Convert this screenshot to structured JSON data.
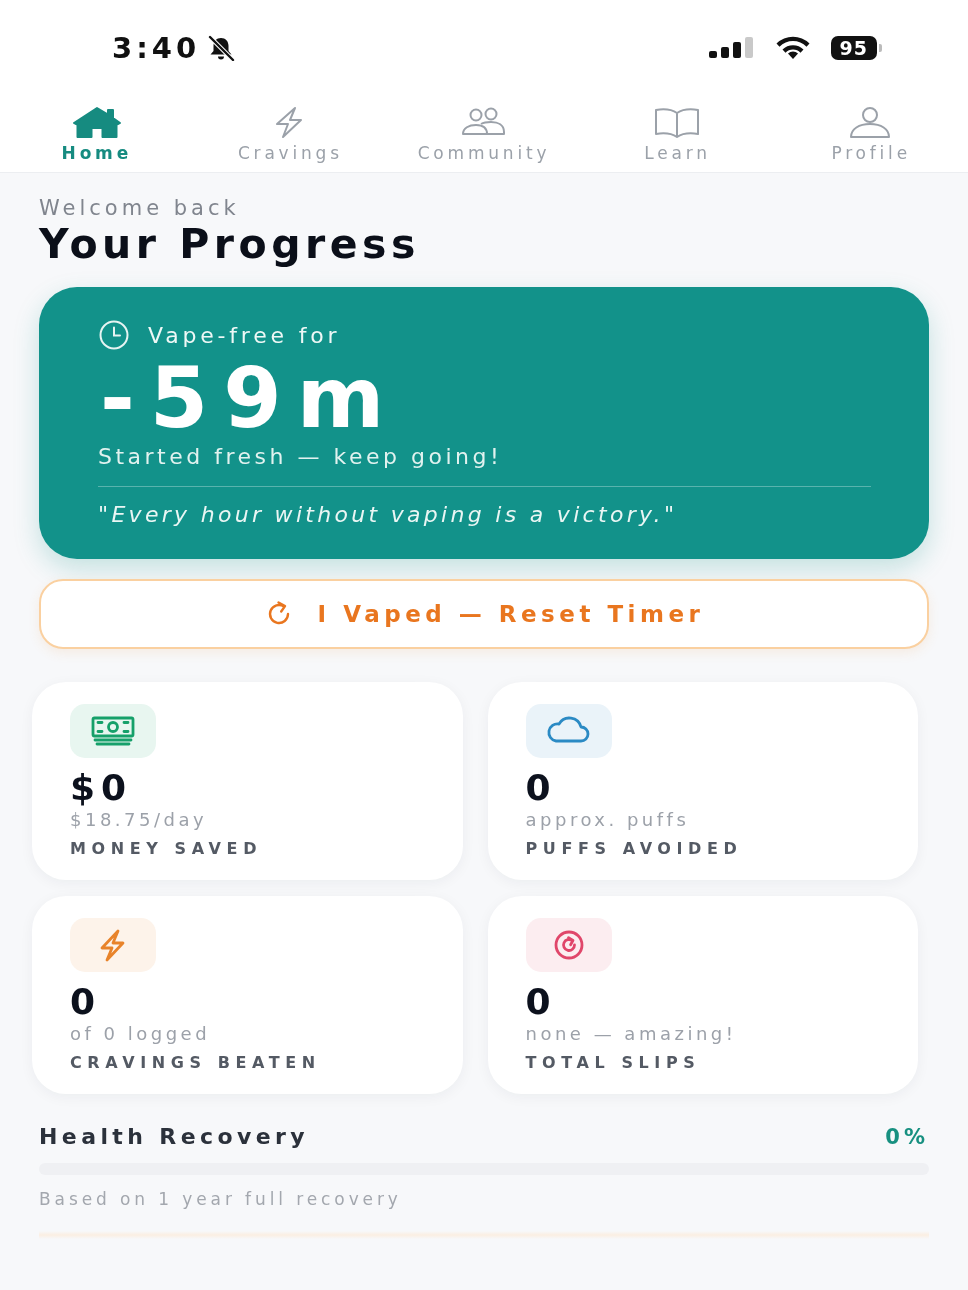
{
  "status_bar": {
    "time": "3:40",
    "battery": "95"
  },
  "tabs": [
    {
      "label": "Home",
      "selected": true
    },
    {
      "label": "Cravings",
      "selected": false
    },
    {
      "label": "Community",
      "selected": false
    },
    {
      "label": "Learn",
      "selected": false
    },
    {
      "label": "Profile",
      "selected": false
    }
  ],
  "header": {
    "subtitle": "Welcome back",
    "title": "Your Progress"
  },
  "timer_card": {
    "label": "Vape-free for",
    "value": "-59m",
    "message": "Started fresh — keep going!",
    "quote": "\"Every hour without vaping is a victory.\""
  },
  "reset_button": {
    "label": "I Vaped — Reset Timer"
  },
  "stats": [
    {
      "value": "$0",
      "detail": "$18.75/day",
      "label": "MONEY SAVED",
      "color": "#16a06a"
    },
    {
      "value": "0",
      "detail": "approx. puffs",
      "label": "PUFFS AVOIDED",
      "color": "#2b8ac4"
    },
    {
      "value": "0",
      "detail": "of 0 logged",
      "label": "CRAVINGS BEATEN",
      "color": "#e8832a"
    },
    {
      "value": "0",
      "detail": "none — amazing!",
      "label": "TOTAL SLIPS",
      "color": "#e0466a"
    }
  ],
  "health": {
    "title": "Health Recovery",
    "percent": "0%",
    "level": 0,
    "note": "Based on 1 year full recovery"
  }
}
